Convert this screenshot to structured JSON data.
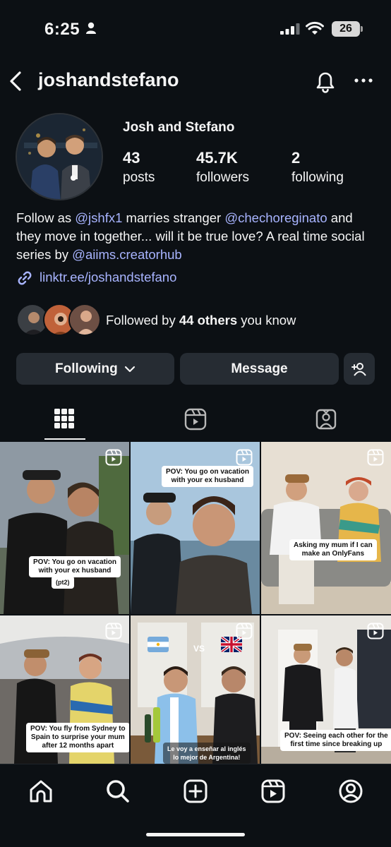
{
  "status_bar": {
    "time": "6:25",
    "battery": "26"
  },
  "header": {
    "username": "joshandstefano"
  },
  "profile": {
    "display_name": "Josh and Stefano",
    "stats": [
      {
        "value": "43",
        "label": "posts"
      },
      {
        "value": "45.7K",
        "label": "followers"
      },
      {
        "value": "2",
        "label": "following"
      }
    ],
    "bio": {
      "part1": "Follow as ",
      "mention1": "@jshfx1",
      "part2": " marries stranger ",
      "mention2": "@chechoreginato",
      "part3": " and they move in together... will it be true love? A real time social series by ",
      "mention3": "@aiims.creatorhub"
    },
    "link": "linktr.ee/joshandstefano",
    "followed_by": {
      "prefix": "Followed by ",
      "count": "44 others",
      "suffix": " you know"
    }
  },
  "actions": {
    "following": "Following",
    "message": "Message"
  },
  "tabs": [
    "posts-grid",
    "reels",
    "tagged"
  ],
  "grid": {
    "captions": [
      "POV: You go on vacation\nwith your ex husband",
      "(pt2)",
      "POV: You go on vacation\nwith your ex husband",
      "Asking my mum if I can\nmake an OnlyFans",
      "POV: You fly from Sydney to\nSpain to surprise your mum\nafter 12 months apart",
      "VS",
      "Le voy a enseñar al inglés\nlo mejor de Argentina!",
      "POV: Seeing each other for the\nfirst time since breaking up"
    ]
  },
  "colors": {
    "background": "#0c1014",
    "button": "#262c33",
    "link": "#a8b4ff",
    "text": "#f5f5f5"
  },
  "nav": [
    "home-icon",
    "search-icon",
    "create-icon",
    "reels-icon",
    "profile-icon"
  ]
}
